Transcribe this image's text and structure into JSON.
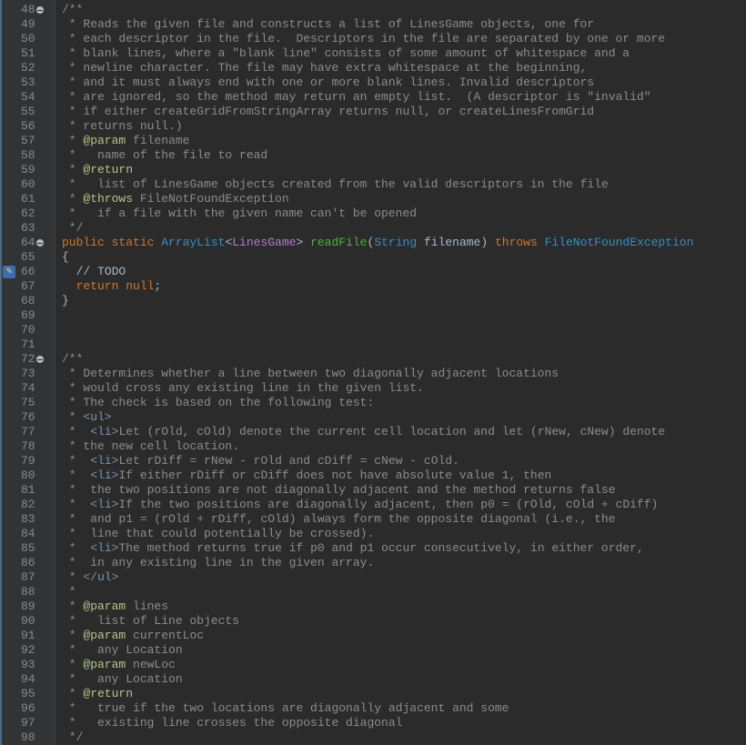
{
  "editor": {
    "lines": [
      {
        "num": "48",
        "fold": true,
        "segs": [
          [
            "c",
            "/**"
          ]
        ]
      },
      {
        "num": "49",
        "segs": [
          [
            "c",
            " * Reads the given file and constructs a list of LinesGame objects, one for"
          ]
        ]
      },
      {
        "num": "50",
        "segs": [
          [
            "c",
            " * each descriptor in the file.  Descriptors in the file are separated by one or more"
          ]
        ]
      },
      {
        "num": "51",
        "segs": [
          [
            "c",
            " * blank lines, where a \"blank line\" consists of some amount of whitespace and a"
          ]
        ]
      },
      {
        "num": "52",
        "segs": [
          [
            "c",
            " * newline character. The file may have extra whitespace at the beginning,"
          ]
        ]
      },
      {
        "num": "53",
        "segs": [
          [
            "c",
            " * and it must always end with one or more blank lines. Invalid descriptors"
          ]
        ]
      },
      {
        "num": "54",
        "segs": [
          [
            "c",
            " * are ignored, so the method may return an empty list.  (A descriptor is \"invalid\""
          ]
        ]
      },
      {
        "num": "55",
        "segs": [
          [
            "c",
            " * if either createGridFromStringArray returns null, or createLinesFromGrid"
          ]
        ]
      },
      {
        "num": "56",
        "segs": [
          [
            "c",
            " * returns null.)"
          ]
        ]
      },
      {
        "num": "57",
        "segs": [
          [
            "c",
            " * "
          ],
          [
            "tag",
            "@param"
          ],
          [
            "c",
            " filename"
          ]
        ]
      },
      {
        "num": "58",
        "segs": [
          [
            "c",
            " *   name of the file to read"
          ]
        ]
      },
      {
        "num": "59",
        "segs": [
          [
            "c",
            " * "
          ],
          [
            "tag",
            "@return"
          ]
        ]
      },
      {
        "num": "60",
        "segs": [
          [
            "c",
            " *   list of LinesGame objects created from the valid descriptors in the file"
          ]
        ]
      },
      {
        "num": "61",
        "segs": [
          [
            "c",
            " * "
          ],
          [
            "tag",
            "@throws"
          ],
          [
            "c",
            " FileNotFoundException"
          ]
        ]
      },
      {
        "num": "62",
        "segs": [
          [
            "c",
            " *   if a file with the given name can't be opened"
          ]
        ]
      },
      {
        "num": "63",
        "segs": [
          [
            "c",
            " */"
          ]
        ]
      },
      {
        "num": "64",
        "fold": true,
        "segs": [
          [
            "kw",
            "public static "
          ],
          [
            "type",
            "ArrayList"
          ],
          [
            "plain",
            "<"
          ],
          [
            "gen",
            "LinesGame"
          ],
          [
            "plain",
            "> "
          ],
          [
            "fn",
            "readFile"
          ],
          [
            "plain",
            "("
          ],
          [
            "type",
            "String"
          ],
          [
            "plain",
            " "
          ],
          [
            "param",
            "filename"
          ],
          [
            "plain",
            ") "
          ],
          [
            "kw",
            "throws "
          ],
          [
            "type",
            "FileNotFoundException"
          ]
        ]
      },
      {
        "num": "65",
        "segs": [
          [
            "plain",
            "{"
          ]
        ]
      },
      {
        "num": "66",
        "marker": true,
        "segs": [
          [
            "plain",
            "  "
          ],
          [
            "todo",
            "// TODO"
          ]
        ]
      },
      {
        "num": "67",
        "segs": [
          [
            "kw",
            "  return null"
          ],
          [
            "plain",
            ";"
          ]
        ]
      },
      {
        "num": "68",
        "segs": [
          [
            "plain",
            "}"
          ]
        ]
      },
      {
        "num": "69",
        "segs": []
      },
      {
        "num": "70",
        "segs": []
      },
      {
        "num": "71",
        "segs": []
      },
      {
        "num": "72",
        "fold": true,
        "segs": [
          [
            "c",
            "/**"
          ]
        ]
      },
      {
        "num": "73",
        "segs": [
          [
            "c",
            " * Determines whether a line between two diagonally adjacent locations"
          ]
        ]
      },
      {
        "num": "74",
        "segs": [
          [
            "c",
            " * would cross any existing line in the given list."
          ]
        ]
      },
      {
        "num": "75",
        "segs": [
          [
            "c",
            " * The check is based on the following test:"
          ]
        ]
      },
      {
        "num": "76",
        "segs": [
          [
            "c",
            " * "
          ],
          [
            "html",
            "<ul>"
          ]
        ]
      },
      {
        "num": "77",
        "segs": [
          [
            "c",
            " *  "
          ],
          [
            "html",
            "<li>"
          ],
          [
            "c",
            "Let (rOld, cOld) denote the current cell location and let (rNew, cNew) denote"
          ]
        ]
      },
      {
        "num": "78",
        "segs": [
          [
            "c",
            " * the new cell location."
          ]
        ]
      },
      {
        "num": "79",
        "segs": [
          [
            "c",
            " *  "
          ],
          [
            "html",
            "<li>"
          ],
          [
            "c",
            "Let rDiff = rNew - rOld and cDiff = cNew - cOld."
          ]
        ]
      },
      {
        "num": "80",
        "segs": [
          [
            "c",
            " *  "
          ],
          [
            "html",
            "<li>"
          ],
          [
            "c",
            "If either rDiff or cDiff does not have absolute value 1, then"
          ]
        ]
      },
      {
        "num": "81",
        "segs": [
          [
            "c",
            " *  the two positions are not diagonally adjacent and the method returns false"
          ]
        ]
      },
      {
        "num": "82",
        "segs": [
          [
            "c",
            " *  "
          ],
          [
            "html",
            "<li>"
          ],
          [
            "c",
            "If the two positions are diagonally adjacent, then p0 = (rOld, cOld + cDiff)"
          ]
        ]
      },
      {
        "num": "83",
        "segs": [
          [
            "c",
            " *  and p1 = (rOld + rDiff, cOld) always form the opposite diagonal (i.e., the"
          ]
        ]
      },
      {
        "num": "84",
        "segs": [
          [
            "c",
            " *  line that could potentially be crossed)."
          ]
        ]
      },
      {
        "num": "85",
        "segs": [
          [
            "c",
            " *  "
          ],
          [
            "html",
            "<li>"
          ],
          [
            "c",
            "The method returns true if p0 and p1 occur consecutively, in either order,"
          ]
        ]
      },
      {
        "num": "86",
        "segs": [
          [
            "c",
            " *  in any existing line in the given array."
          ]
        ]
      },
      {
        "num": "87",
        "segs": [
          [
            "c",
            " * "
          ],
          [
            "html",
            "</ul>"
          ]
        ]
      },
      {
        "num": "88",
        "segs": [
          [
            "c",
            " *"
          ]
        ]
      },
      {
        "num": "89",
        "segs": [
          [
            "c",
            " * "
          ],
          [
            "tag",
            "@param"
          ],
          [
            "c",
            " lines"
          ]
        ]
      },
      {
        "num": "90",
        "segs": [
          [
            "c",
            " *   list of Line objects"
          ]
        ]
      },
      {
        "num": "91",
        "segs": [
          [
            "c",
            " * "
          ],
          [
            "tag",
            "@param"
          ],
          [
            "c",
            " currentLoc"
          ]
        ]
      },
      {
        "num": "92",
        "segs": [
          [
            "c",
            " *   any Location"
          ]
        ]
      },
      {
        "num": "93",
        "segs": [
          [
            "c",
            " * "
          ],
          [
            "tag",
            "@param"
          ],
          [
            "c",
            " newLoc"
          ]
        ]
      },
      {
        "num": "94",
        "segs": [
          [
            "c",
            " *   any Location"
          ]
        ]
      },
      {
        "num": "95",
        "segs": [
          [
            "c",
            " * "
          ],
          [
            "tag",
            "@return"
          ]
        ]
      },
      {
        "num": "96",
        "segs": [
          [
            "c",
            " *   true if the two locations are diagonally adjacent and some"
          ]
        ]
      },
      {
        "num": "97",
        "segs": [
          [
            "c",
            " *   existing line crosses the opposite diagonal"
          ]
        ]
      },
      {
        "num": "98",
        "segs": [
          [
            "c",
            " */"
          ]
        ]
      }
    ],
    "colors": {
      "background": "#2b2b2b",
      "gutter": "#313335",
      "comment": "#8c8c8c",
      "doc_tag": "#b3c58a",
      "keyword": "#cc7832",
      "type": "#3a8ec0",
      "method": "#4fb13c"
    },
    "marker_icon": "implementation-marker-icon",
    "fold_icon": "fold-toggle-icon"
  }
}
